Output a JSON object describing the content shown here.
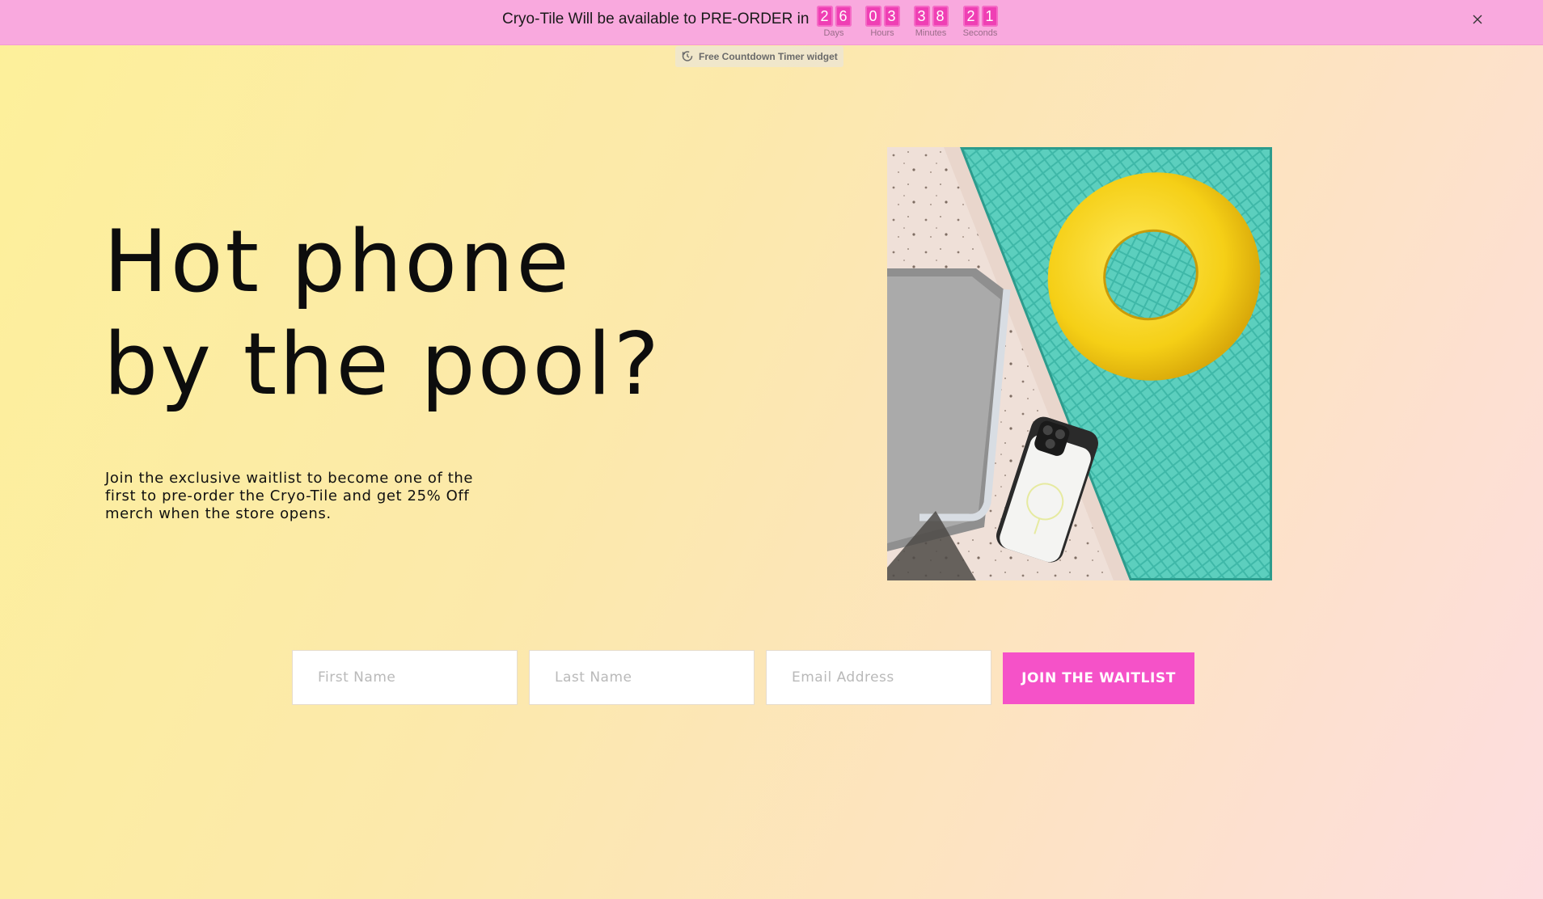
{
  "announcement": {
    "message": "Cryo-Tile Will be available to PRE-ORDER in",
    "countdown": [
      {
        "digits": [
          "2",
          "6"
        ],
        "label": "Days"
      },
      {
        "digits": [
          "0",
          "3"
        ],
        "label": "Hours"
      },
      {
        "digits": [
          "3",
          "8"
        ],
        "label": "Minutes"
      },
      {
        "digits": [
          "2",
          "1"
        ],
        "label": "Seconds"
      }
    ],
    "close_icon": "close-icon",
    "bar_color": "#f9a9de",
    "digit_color": "#ef3fb4"
  },
  "widget_badge": {
    "label": "Free Countdown Timer widget",
    "icon": "timer-icon"
  },
  "hero": {
    "title_line1": "Hot phone",
    "title_line2": "by the pool?",
    "subtitle": "Join the exclusive waitlist to become one of the first to pre-order the Cryo-Tile and get 25% Off merch when the store opens."
  },
  "form": {
    "first_name": {
      "placeholder": "First Name",
      "value": ""
    },
    "last_name": {
      "placeholder": "Last Name",
      "value": ""
    },
    "email": {
      "placeholder": "Email Address",
      "value": ""
    },
    "submit_label": "JOIN THE WAITLIST",
    "button_color": "#f552c8"
  }
}
